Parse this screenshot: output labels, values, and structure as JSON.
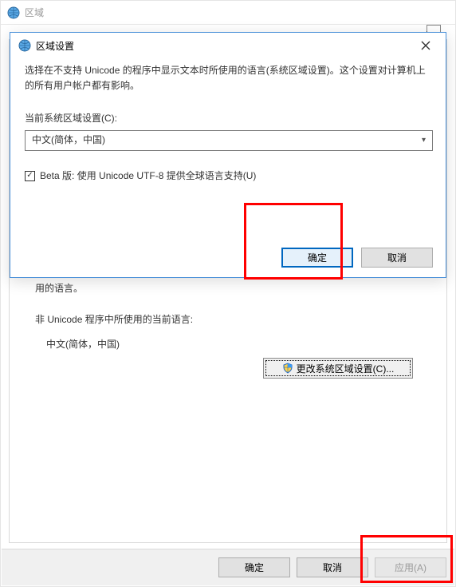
{
  "parent": {
    "title": "区域",
    "footer": {
      "ok": "确定",
      "cancel": "取消",
      "apply": "应用(A)"
    },
    "section": {
      "truncated_line": "用的语言。",
      "current_lang_label": "非 Unicode 程序中所使用的当前语言:",
      "current_lang_value": "中文(简体，中国)",
      "change_button": "更改系统区域设置(C)..."
    }
  },
  "modal": {
    "title": "区域设置",
    "description": "选择在不支持 Unicode 的程序中显示文本时所使用的语言(系统区域设置)。这个设置对计算机上的所有用户帐户都有影响。",
    "current_label": "当前系统区域设置(C):",
    "select_value": "中文(简体，中国)",
    "checkbox_label": "Beta 版: 使用 Unicode UTF-8 提供全球语言支持(U)",
    "ok": "确定",
    "cancel": "取消"
  }
}
